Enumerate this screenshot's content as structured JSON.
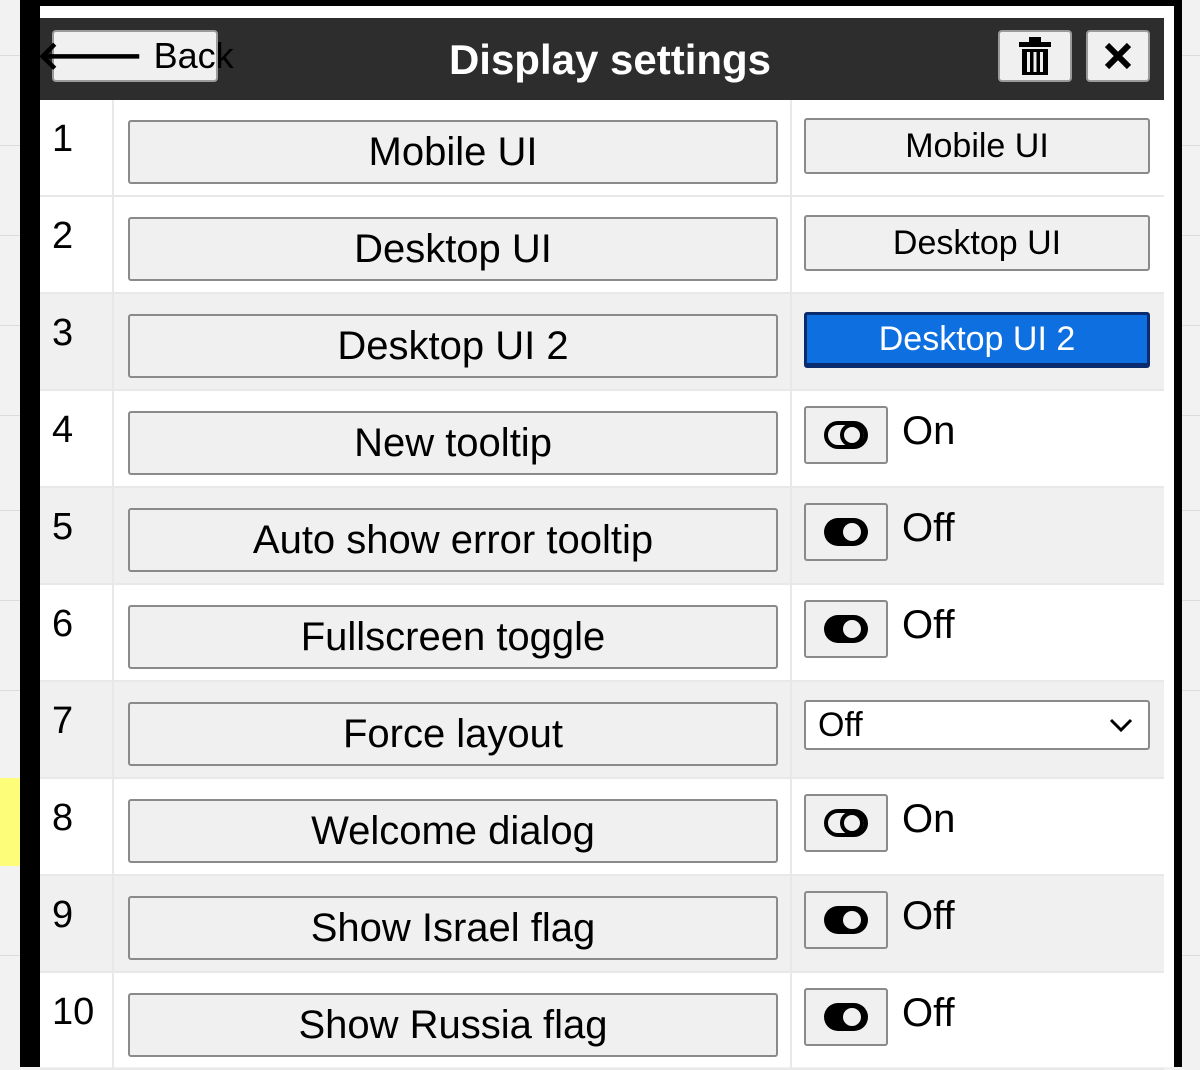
{
  "header": {
    "back_label": "Back",
    "title": "Display settings",
    "trash_icon": "trash-icon",
    "close_icon": "close-icon"
  },
  "rows": [
    {
      "num": "1",
      "label": "Mobile UI",
      "control": "button",
      "value": "Mobile UI",
      "active": false
    },
    {
      "num": "2",
      "label": "Desktop UI",
      "control": "button",
      "value": "Desktop UI",
      "active": false
    },
    {
      "num": "3",
      "label": "Desktop UI 2",
      "control": "button",
      "value": "Desktop UI 2",
      "active": true
    },
    {
      "num": "4",
      "label": "New tooltip",
      "control": "toggle",
      "value": "On"
    },
    {
      "num": "5",
      "label": "Auto show error tooltip",
      "control": "toggle",
      "value": "Off"
    },
    {
      "num": "6",
      "label": "Fullscreen toggle",
      "control": "toggle",
      "value": "Off"
    },
    {
      "num": "7",
      "label": "Force layout",
      "control": "select",
      "value": "Off"
    },
    {
      "num": "8",
      "label": "Welcome dialog",
      "control": "toggle",
      "value": "On"
    },
    {
      "num": "9",
      "label": "Show Israel flag",
      "control": "toggle",
      "value": "Off"
    },
    {
      "num": "10",
      "label": "Show Russia flag",
      "control": "toggle",
      "value": "Off"
    }
  ],
  "colors": {
    "header_bg": "#2d2d2d",
    "active_button": "#0d6fe0",
    "row_shade": "#f0f0f0"
  }
}
